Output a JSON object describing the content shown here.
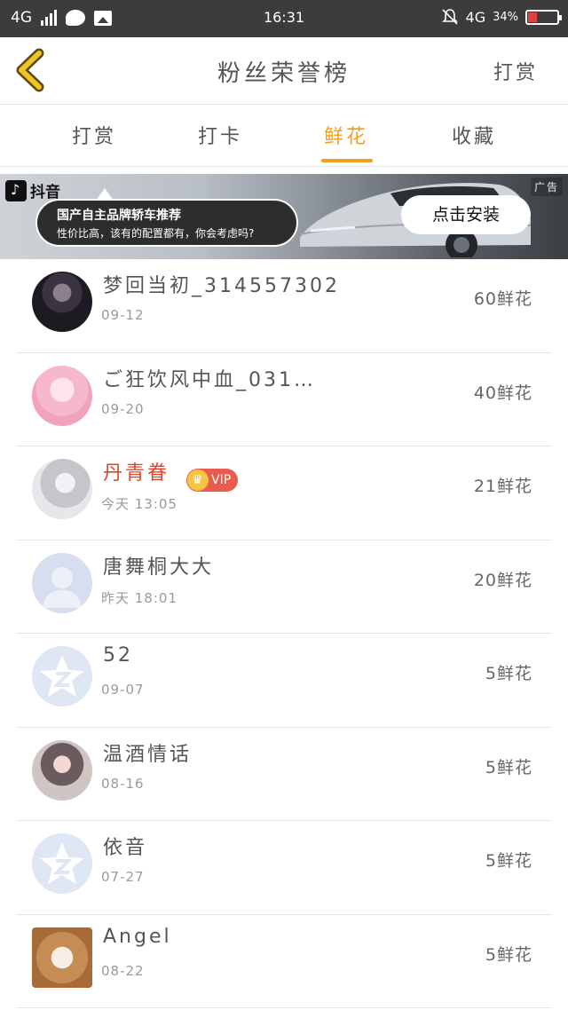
{
  "status_bar": {
    "network": "4G",
    "time": "16:31",
    "network_right": "4G",
    "battery": "34%",
    "battery_level": 0.34
  },
  "header": {
    "title": "粉丝荣誉榜",
    "action": "打赏"
  },
  "tabs": [
    {
      "label": "打赏",
      "active": false
    },
    {
      "label": "打卡",
      "active": false
    },
    {
      "label": "鲜花",
      "active": true
    },
    {
      "label": "收藏",
      "active": false
    }
  ],
  "ad": {
    "brand": "抖音",
    "headline": "国产自主品牌轿车推荐",
    "subtext": "性价比高，该有的配置都有，你会考虑吗?",
    "cta": "点击安装",
    "label": "广告"
  },
  "list": [
    {
      "name": "梦回当初_314557302",
      "date": "09-12",
      "count": "60鲜花",
      "avatar": "dark-anime-avatar"
    },
    {
      "name": "ご狂饮风中血_031…",
      "date": "09-20",
      "count": "40鲜花",
      "avatar": "pink-anime-avatar"
    },
    {
      "name": "丹青眷",
      "date": "今天 13:05",
      "count": "21鲜花",
      "avatar": "white-hair-avatar",
      "vip": "VIP"
    },
    {
      "name": "唐舞桐大大",
      "date": "昨天 18:01",
      "count": "20鲜花",
      "avatar": "default-person-avatar"
    },
    {
      "name": "52",
      "date": "09-07",
      "count": "5鲜花",
      "avatar": "qzone-star-avatar"
    },
    {
      "name": "温酒情话",
      "date": "08-16",
      "count": "5鲜花",
      "avatar": "photo-avatar"
    },
    {
      "name": "依音",
      "date": "07-27",
      "count": "5鲜花",
      "avatar": "qzone-star-avatar"
    },
    {
      "name": "Angel",
      "date": "08-22",
      "count": "5鲜花",
      "avatar": "crown-photo-avatar"
    }
  ],
  "colors": {
    "accent": "#f0a020",
    "vip_red": "#ea5b4d",
    "name_highlight": "#e0442a"
  }
}
